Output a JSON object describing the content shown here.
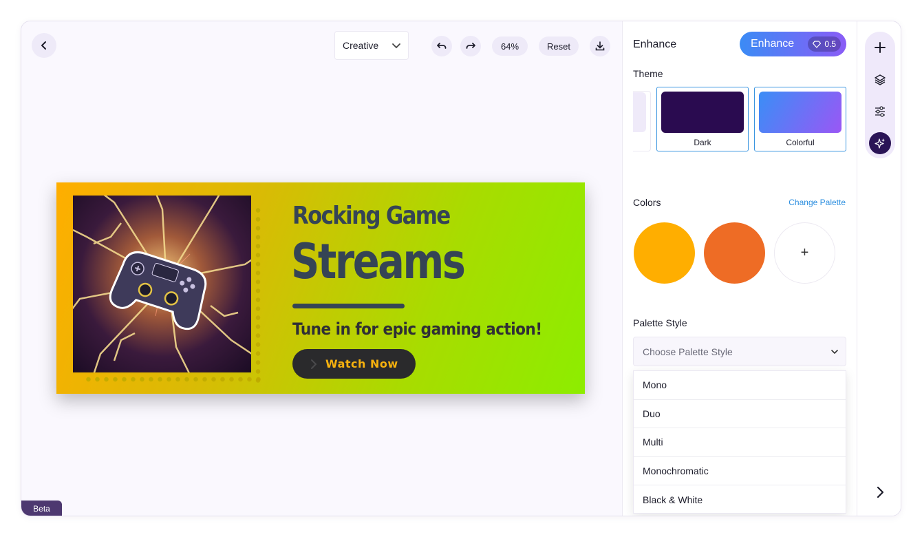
{
  "toolbar": {
    "mode": "Creative",
    "zoom": "64%",
    "reset_label": "Reset"
  },
  "banner": {
    "title_line1": "Rocking Game",
    "title_line2": "Streams",
    "subtitle": "Tune in for epic gaming action!",
    "cta": "Watch Now"
  },
  "beta_label": "Beta",
  "panel": {
    "title": "Enhance",
    "enhance_button": "Enhance",
    "enhance_cost": "0.5",
    "theme_label": "Theme",
    "themes": [
      {
        "label": "Dark",
        "color": "#2a0b50"
      },
      {
        "label": "Colorful",
        "color_from": "#3a8ef6",
        "color_to": "#9a57f5"
      }
    ],
    "colors_label": "Colors",
    "change_palette": "Change Palette",
    "palette_colors": [
      "#ffae00",
      "#ee6c25"
    ],
    "add_color": "+",
    "palette_style_label": "Palette Style",
    "palette_style_placeholder": "Choose Palette Style",
    "palette_style_options": [
      "Mono",
      "Duo",
      "Multi",
      "Monochromatic",
      "Black & White"
    ]
  },
  "icons": {
    "back": "chevron-left-icon",
    "undo": "undo-icon",
    "redo": "redo-icon",
    "download": "download-icon",
    "add": "plus-icon",
    "layers": "layers-icon",
    "adjust": "sliders-icon",
    "enhance": "sparkles-icon",
    "next": "chevron-right-icon"
  }
}
